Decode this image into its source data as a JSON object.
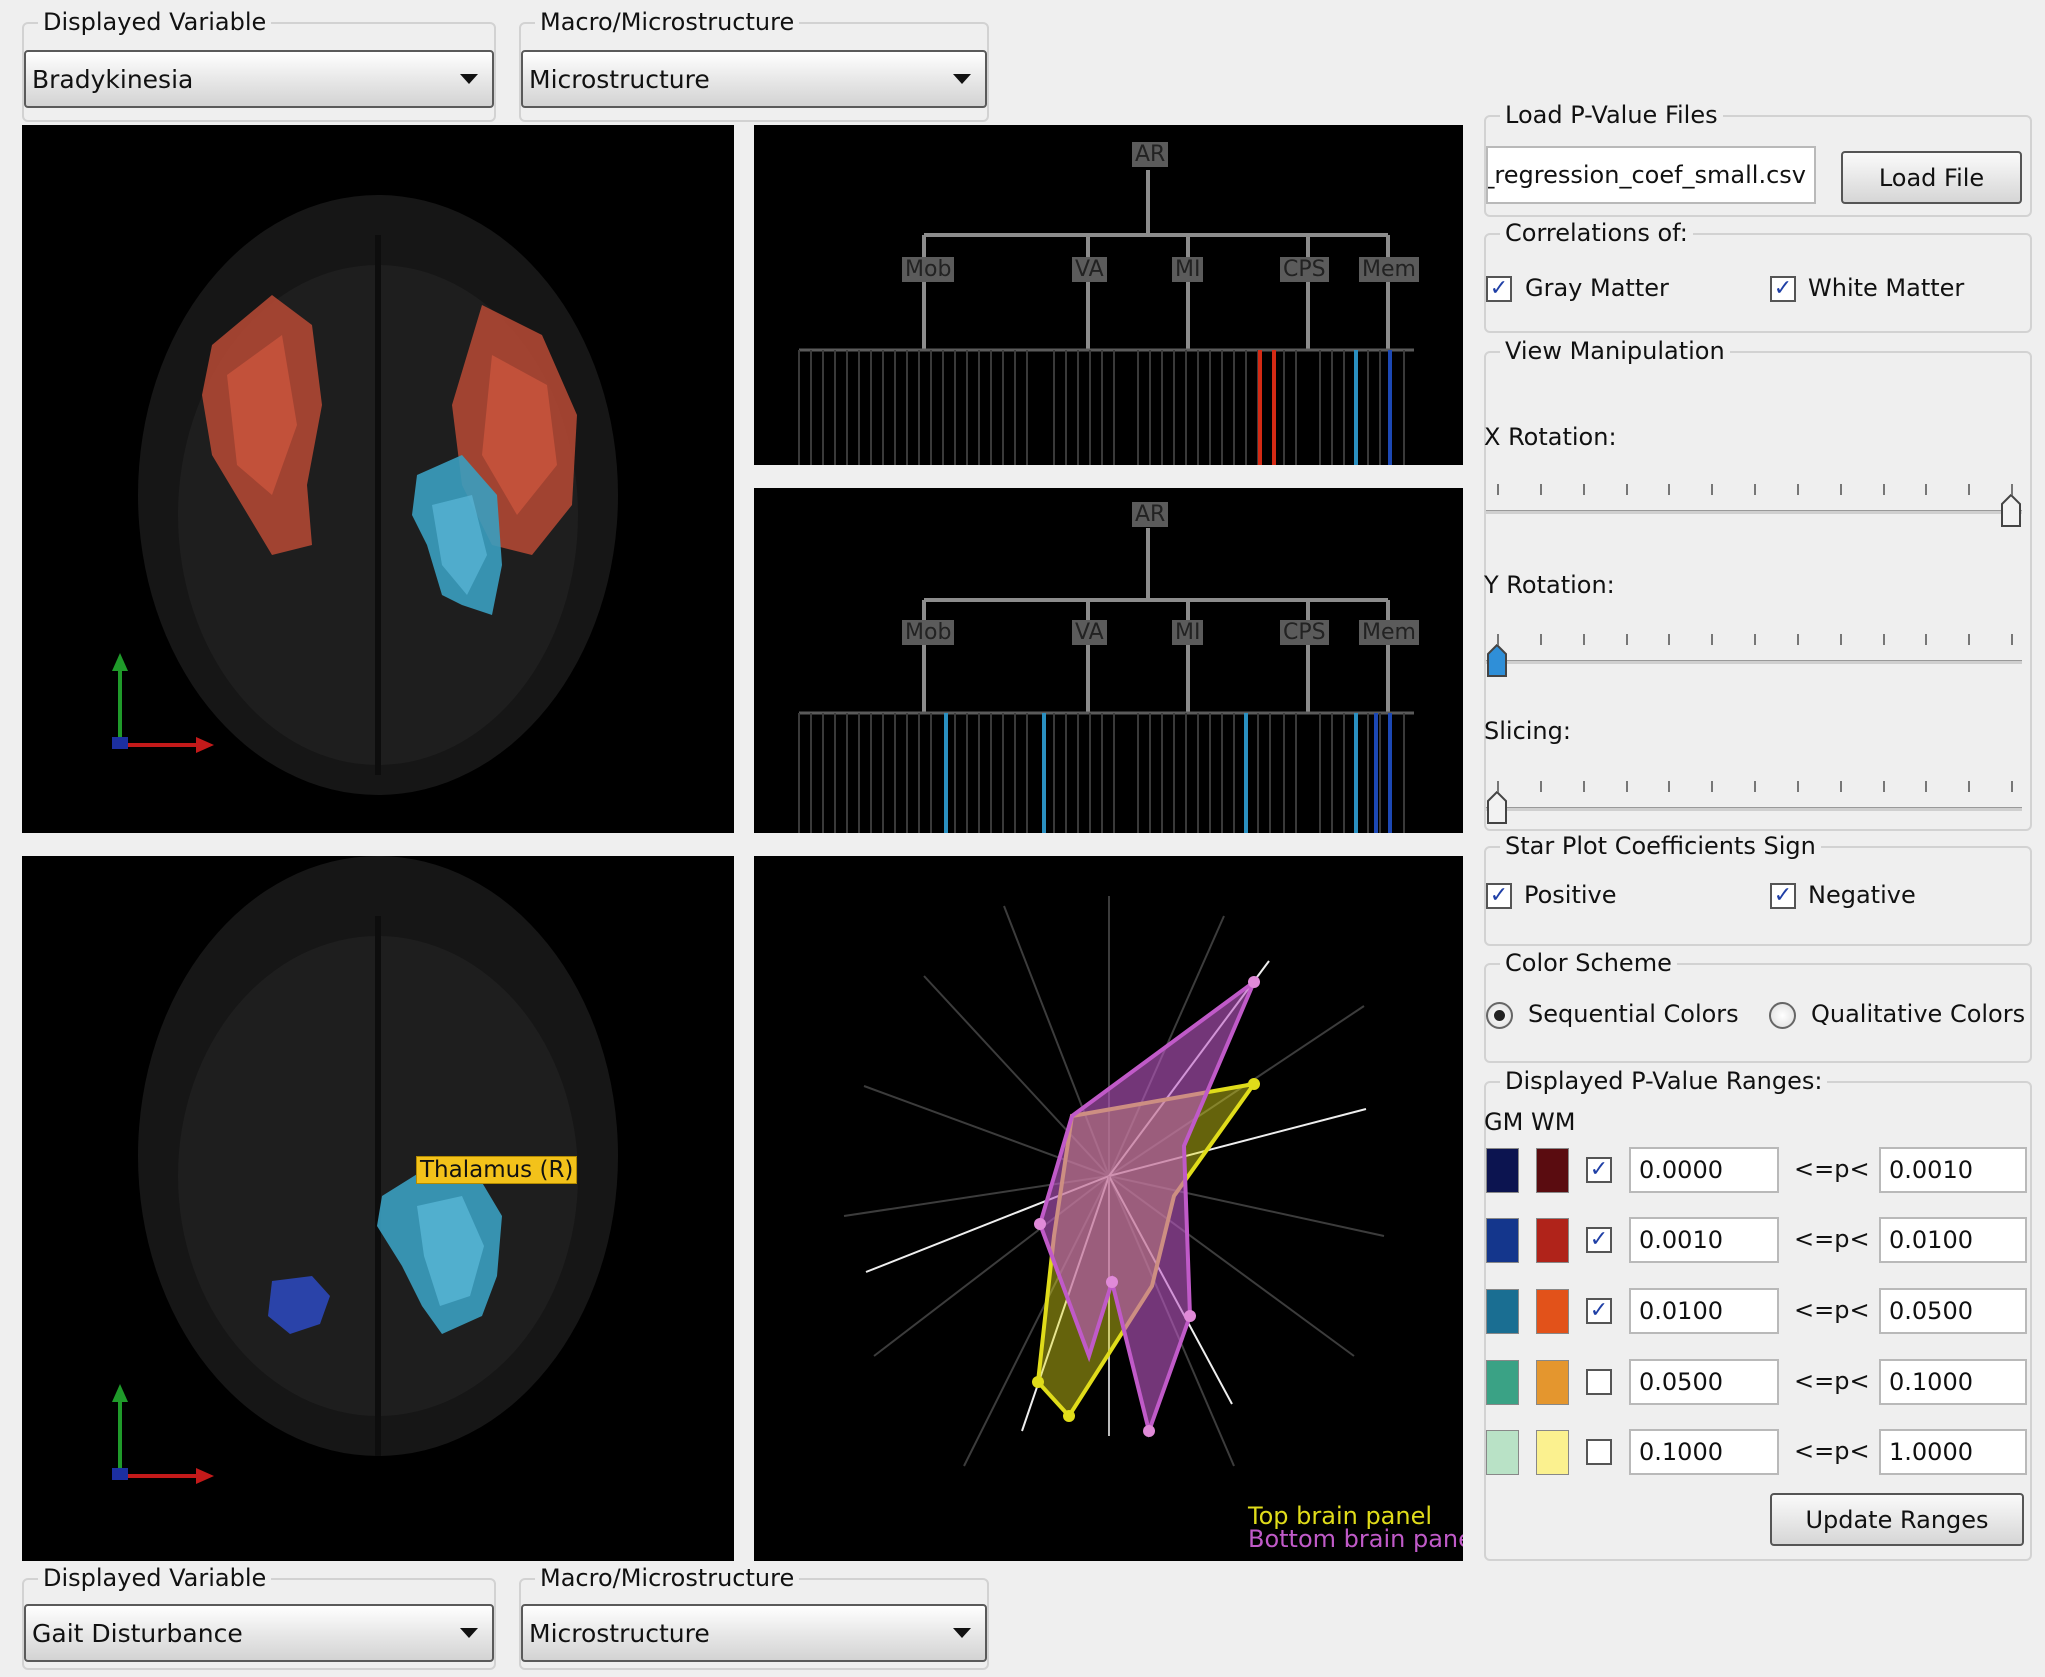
{
  "top_controls": {
    "variable_title": "Displayed Variable",
    "variable_value": "Bradykinesia",
    "structure_title": "Macro/Microstructure",
    "structure_value": "Microstructure"
  },
  "bottom_controls": {
    "variable_title": "Displayed Variable",
    "variable_value": "Gait Disturbance",
    "structure_title": "Macro/Microstructure",
    "structure_value": "Microstructure"
  },
  "tree": {
    "root": "AR",
    "groups": [
      "Mob",
      "VA",
      "MI",
      "CPS",
      "Mem"
    ]
  },
  "brain_bottom": {
    "region_label": "Thalamus (R)"
  },
  "star_plot": {
    "legend_top": "Top brain panel",
    "legend_bottom": "Bottom brain panel",
    "color_top": "#e0dc1a",
    "color_bottom": "#c05ac8"
  },
  "sidebar": {
    "load_title": "Load P-Value Files",
    "file_value": "p_regression_coef_small.csv",
    "load_button": "Load File",
    "correlations_title": "Correlations of:",
    "gray_matter": "Gray Matter",
    "white_matter": "White Matter",
    "view_title": "View Manipulation",
    "x_rotation": "X Rotation:",
    "y_rotation": "Y Rotation:",
    "slicing": "Slicing:",
    "x_rotation_level": 1.0,
    "y_rotation_level": 0.0,
    "slicing_level": 0.0,
    "star_title": "Star Plot Coefficients Sign",
    "positive": "Positive",
    "negative": "Negative",
    "color_title": "Color Scheme",
    "sequential": "Sequential Colors",
    "qualitative": "Qualitative Colors",
    "ranges_title": "Displayed P-Value Ranges:",
    "gm_header": "GM",
    "wm_header": "WM",
    "operator": "<=p<",
    "ranges": [
      {
        "gm": "#0c1450",
        "wm": "#5a0c10",
        "checked": true,
        "low": "0.0000",
        "high": "0.0010"
      },
      {
        "gm": "#14368c",
        "wm": "#b0231a",
        "checked": true,
        "low": "0.0010",
        "high": "0.0100"
      },
      {
        "gm": "#1a6e92",
        "wm": "#e2521a",
        "checked": true,
        "low": "0.0100",
        "high": "0.0500"
      },
      {
        "gm": "#3aa285",
        "wm": "#e4962e",
        "checked": false,
        "low": "0.0500",
        "high": "0.1000"
      },
      {
        "gm": "#b9e2c6",
        "wm": "#fbf18f",
        "checked": false,
        "low": "0.1000",
        "high": "1.0000"
      }
    ],
    "update_button": "Update Ranges"
  }
}
